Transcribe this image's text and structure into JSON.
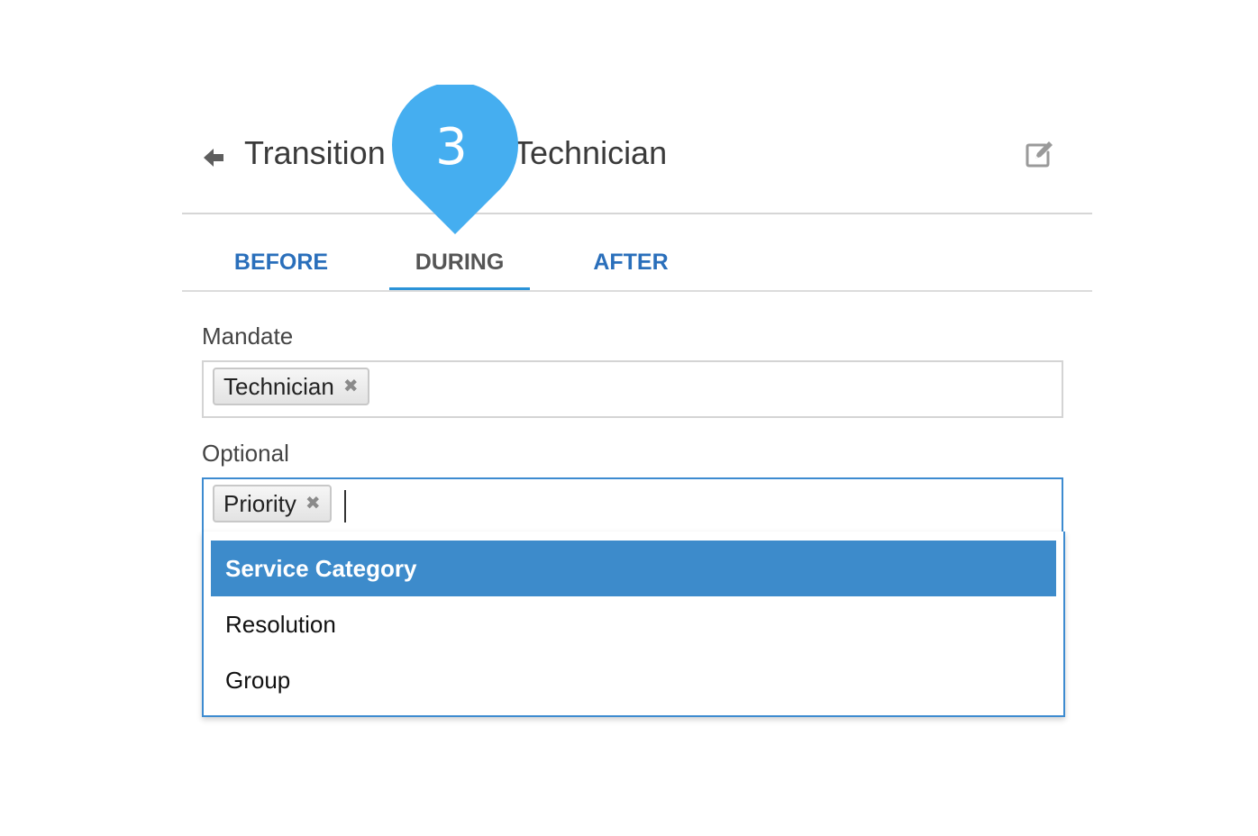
{
  "header": {
    "title_left": "Transition",
    "title_right": "Technician",
    "back_icon": "arrow-left-icon",
    "edit_icon": "edit-icon"
  },
  "step_marker": {
    "number": "3",
    "color": "#45aef0"
  },
  "tabs": [
    {
      "label": "BEFORE",
      "active": false
    },
    {
      "label": "DURING",
      "active": true
    },
    {
      "label": "AFTER",
      "active": false
    }
  ],
  "mandate": {
    "label": "Mandate",
    "tags": [
      {
        "label": "Technician",
        "remove_icon": "close-icon"
      }
    ]
  },
  "optional": {
    "label": "Optional",
    "tags": [
      {
        "label": "Priority",
        "remove_icon": "close-icon"
      }
    ],
    "options": [
      {
        "label": "Service Category",
        "highlighted": true
      },
      {
        "label": "Resolution",
        "highlighted": false
      },
      {
        "label": "Group",
        "highlighted": false
      }
    ]
  },
  "colors": {
    "accent": "#2b93d8",
    "tab_link": "#2a6fbb",
    "highlight": "#3d8bcb",
    "focus_border": "#3d8bd0"
  }
}
